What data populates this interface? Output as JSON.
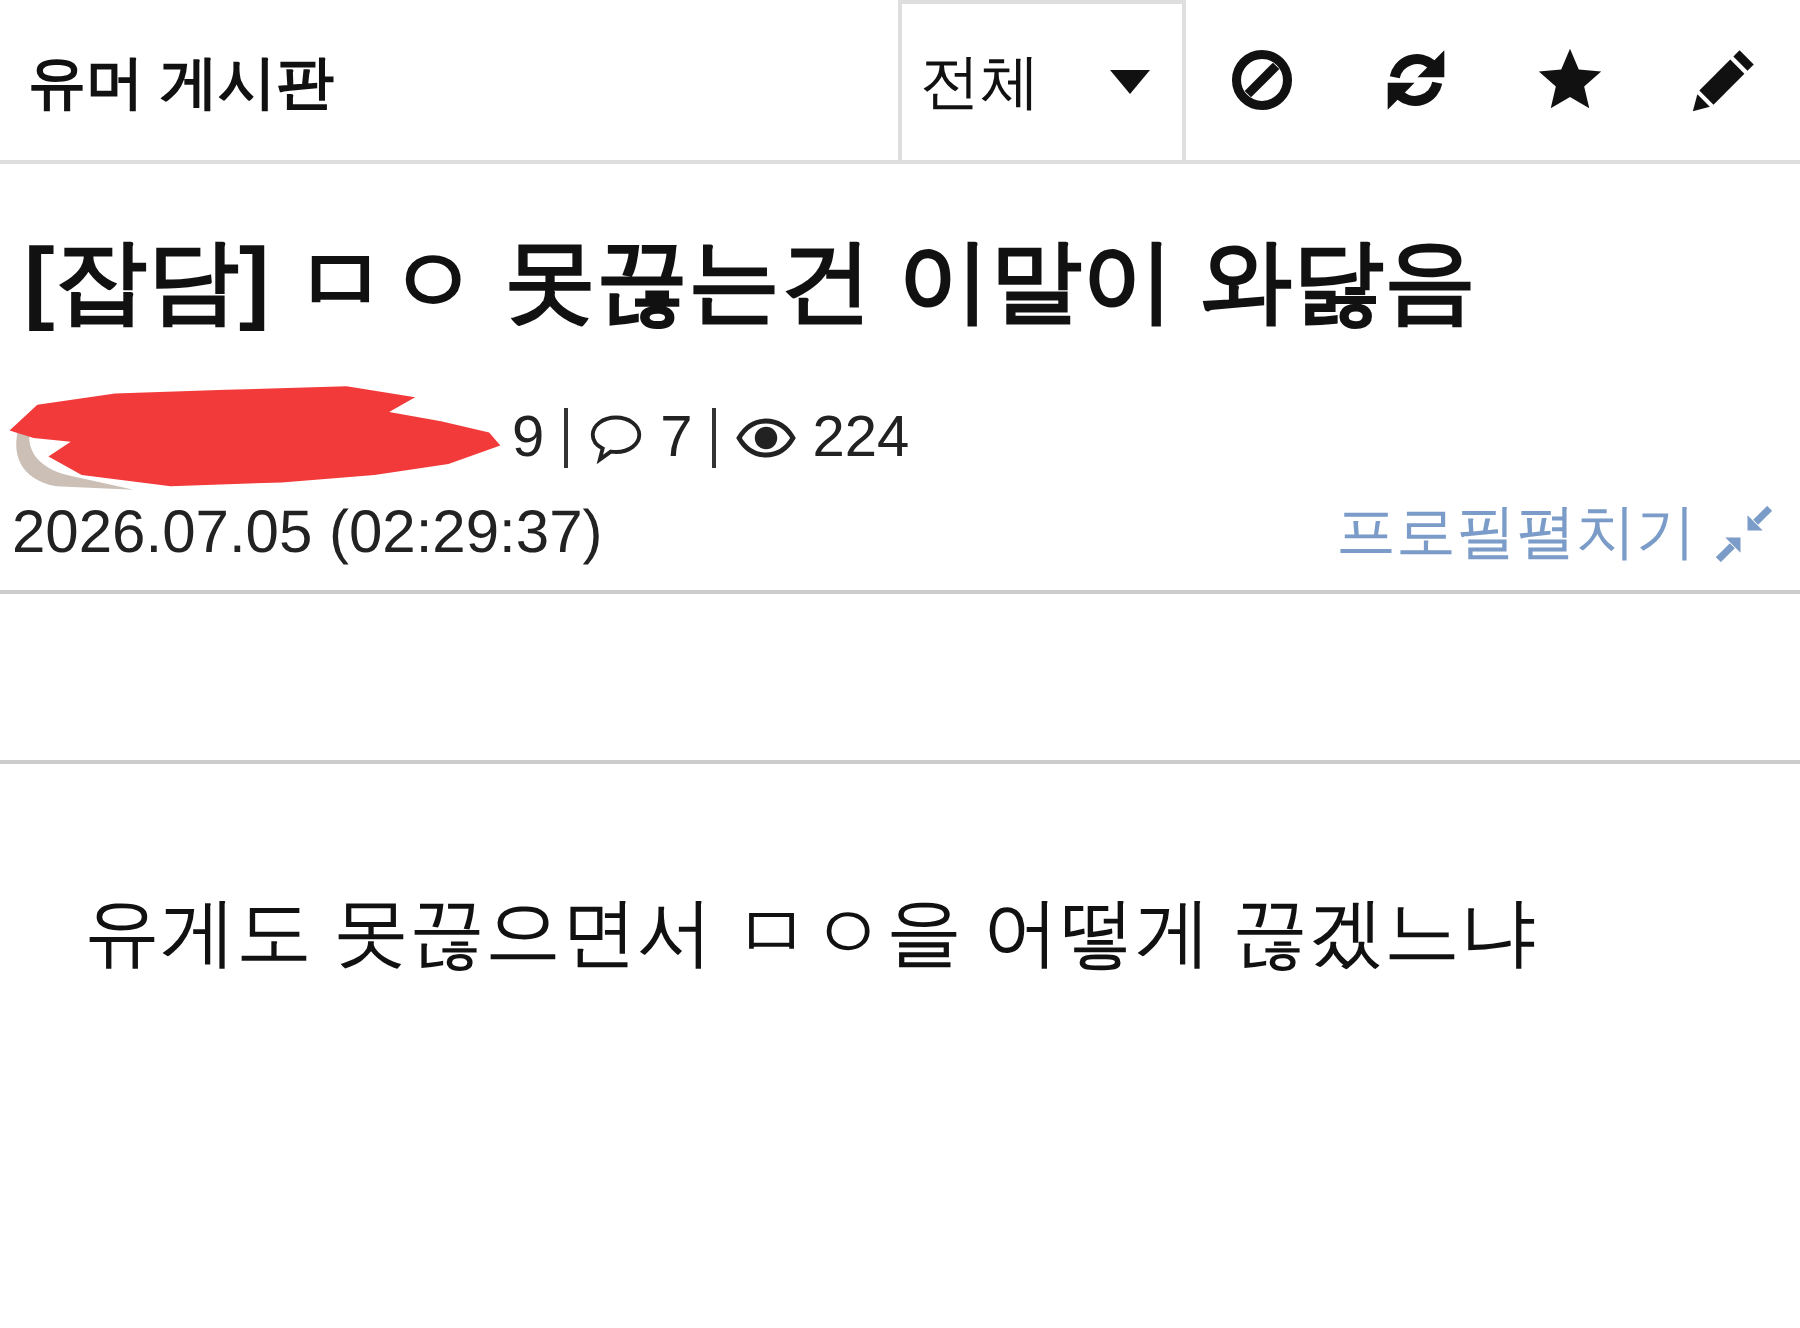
{
  "header": {
    "title": "유머 게시판",
    "filter": {
      "value": "전체"
    }
  },
  "post": {
    "title": "[잡담] ㅁㅇ 못끊는건 이말이 와닳음",
    "meta": {
      "recommends": "9",
      "comments": "7",
      "views": "224"
    },
    "date": "2026.07.05 (02:29:37)",
    "profile_toggle": "프로필펼치기",
    "body": "유게도 못끊으면서 ㅁㅇ을 어떻게 끊겠느냐"
  }
}
